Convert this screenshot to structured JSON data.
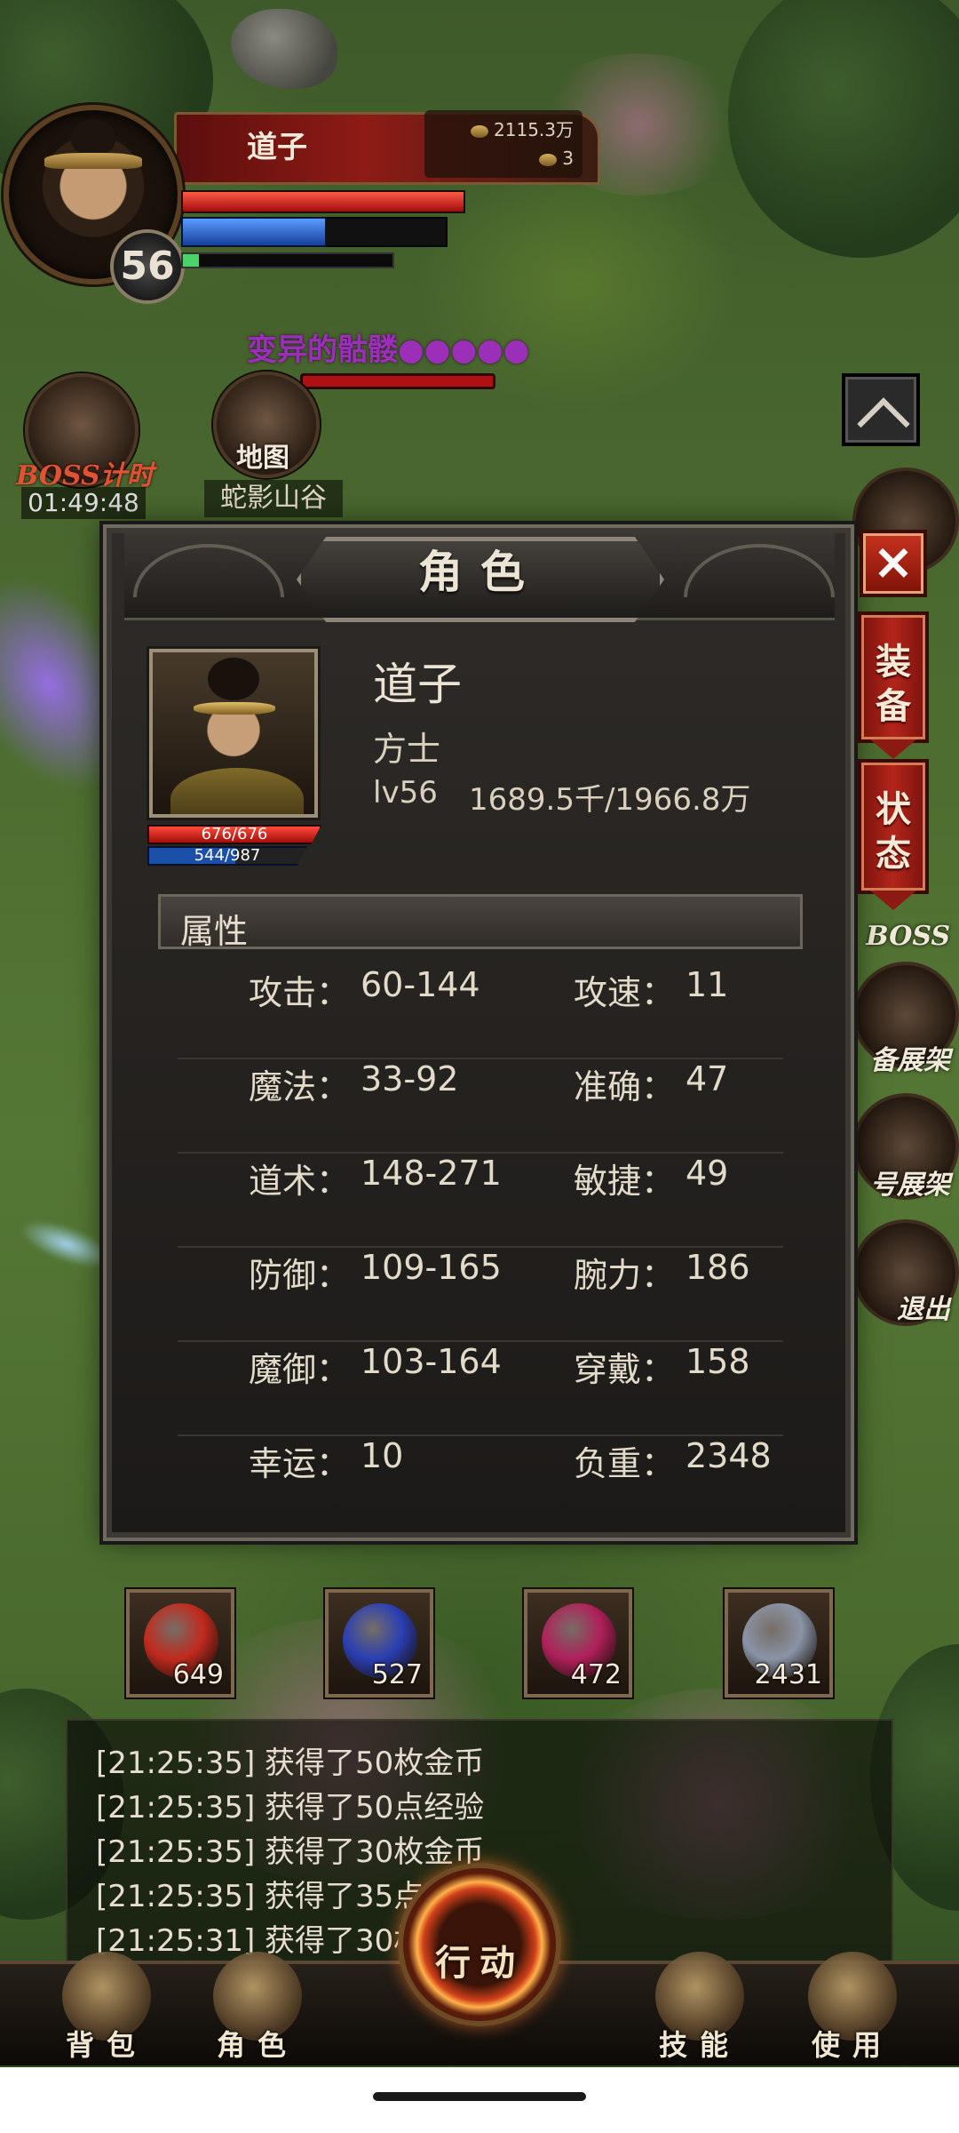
{
  "player": {
    "name": "道子",
    "level": "56",
    "gold": "2115.3万",
    "ingots": "3"
  },
  "enemy": {
    "name": "变异的骷髅●●●●●"
  },
  "buttons": {
    "boss_timer_label": "BOSS计时",
    "boss_timer": "01:49:48",
    "map_label": "地图",
    "map_name": "蛇影山谷",
    "side_boss": "BOSS",
    "side_equip_display": "备展架",
    "side_title_display": "号展架",
    "side_exit": "退出"
  },
  "panel": {
    "title": "角色",
    "close": "×",
    "tabs": [
      {
        "label": "装备"
      },
      {
        "label": "状态"
      }
    ],
    "character": {
      "name": "道子",
      "class": "方士",
      "level": "lv56",
      "exp": "1689.5千/1966.8万",
      "hp": "676/676",
      "mp": "544/987",
      "mp_fraction": 0.551
    },
    "attributes_header": "属性",
    "attributes": [
      {
        "l_label": "攻击：",
        "l_value": "60-144",
        "r_label": "攻速：",
        "r_value": "11"
      },
      {
        "l_label": "魔法：",
        "l_value": "33-92",
        "r_label": "准确：",
        "r_value": "47"
      },
      {
        "l_label": "道术：",
        "l_value": "148-271",
        "r_label": "敏捷：",
        "r_value": "49"
      },
      {
        "l_label": "防御：",
        "l_value": "109-165",
        "r_label": "腕力：",
        "r_value": "186"
      },
      {
        "l_label": "魔御：",
        "l_value": "103-164",
        "r_label": "穿戴：",
        "r_value": "158"
      },
      {
        "l_label": "幸运：",
        "l_value": "10",
        "r_label": "负重：",
        "r_value": "2348"
      }
    ]
  },
  "items": [
    {
      "icon": "red-potion-icon",
      "count": "649",
      "color": "#c22a1e"
    },
    {
      "icon": "blue-potion-icon",
      "count": "527",
      "color": "#2a3fb3"
    },
    {
      "icon": "red-scroll-bundle-icon",
      "count": "472",
      "color": "#b0205a"
    },
    {
      "icon": "silver-scroll-bundle-icon",
      "count": "2431",
      "color": "#8a94a6"
    }
  ],
  "log": [
    "[21:25:35] 获得了50枚金币",
    "[21:25:35] 获得了50点经验",
    "[21:25:35] 获得了30枚金币",
    "[21:25:35] 获得了35点经",
    "[21:25:31] 获得了30枚"
  ],
  "nav": {
    "bag": "背包",
    "role": "角色",
    "action": "行动",
    "skills": "技能",
    "use": "使用"
  }
}
